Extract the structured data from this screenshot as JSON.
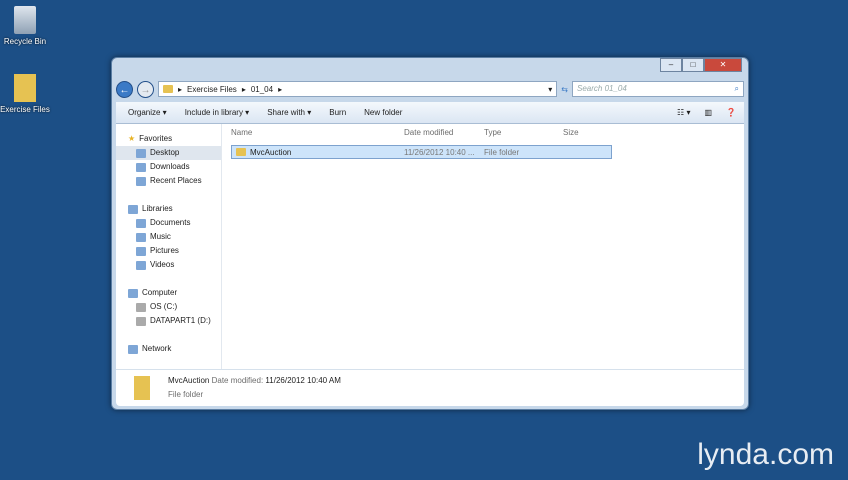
{
  "desktop": {
    "icons": [
      {
        "label": "Recycle Bin"
      },
      {
        "label": "Exercise Files"
      }
    ]
  },
  "window": {
    "address": [
      "Exercise Files",
      "01_04"
    ],
    "search_placeholder": "Search 01_04",
    "toolbar": [
      "Organize ▾",
      "Include in library ▾",
      "Share with ▾",
      "Burn",
      "New folder"
    ],
    "nav": {
      "favorites": {
        "label": "Favorites",
        "items": [
          "Desktop",
          "Downloads",
          "Recent Places"
        ]
      },
      "libraries": {
        "label": "Libraries",
        "items": [
          "Documents",
          "Music",
          "Pictures",
          "Videos"
        ]
      },
      "computer": {
        "label": "Computer",
        "items": [
          "OS (C:)",
          "DATAPART1 (D:)"
        ]
      },
      "network": "Network"
    },
    "columns": [
      "Name",
      "Date modified",
      "Type",
      "Size"
    ],
    "files": [
      {
        "name": "MvcAuction",
        "date": "11/26/2012 10:40 ...",
        "type": "File folder"
      }
    ],
    "status": {
      "name": "MvcAuction",
      "date_label": "Date modified:",
      "date": "11/26/2012 10:40 AM",
      "type": "File folder"
    }
  },
  "watermark": "lynda.com"
}
